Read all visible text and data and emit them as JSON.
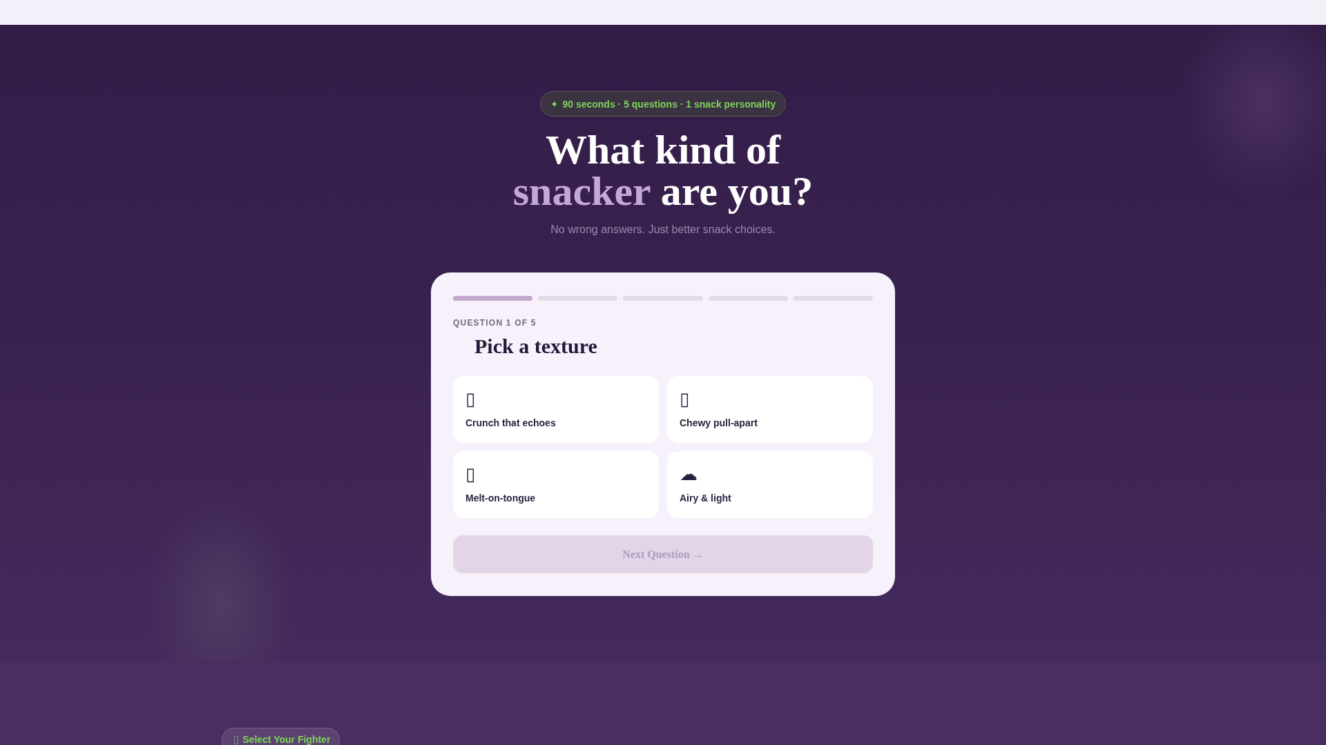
{
  "hero": {
    "badge": {
      "symbol": "✦",
      "text": "90 seconds · 5 questions · 1 snack personality"
    },
    "heading": {
      "lead": "What kind of",
      "highlight": "snacker",
      "tail": "are you?"
    },
    "subtitle": "No wrong answers. Just better snack choices."
  },
  "quiz": {
    "steps": [
      {
        "complete": true
      },
      {
        "complete": false
      },
      {
        "complete": false
      },
      {
        "complete": false
      },
      {
        "complete": false
      }
    ],
    "counter": "QUESTION 1 OF 5",
    "question": "Pick a texture",
    "options": [
      {
        "symbol": "▯",
        "label": "Crunch that echoes",
        "selected": false
      },
      {
        "symbol": "▯",
        "label": "Chewy pull-apart",
        "selected": false
      },
      {
        "symbol": "▯",
        "label": "Melt-on-tongue",
        "selected": false
      },
      {
        "symbol": "☁",
        "label": "Airy & light",
        "selected": false
      }
    ],
    "next_button": {
      "label": "Next Question →",
      "disabled": true
    }
  },
  "next_section": {
    "badge": {
      "symbol": "▯",
      "text": "Select Your Fighter"
    }
  }
}
